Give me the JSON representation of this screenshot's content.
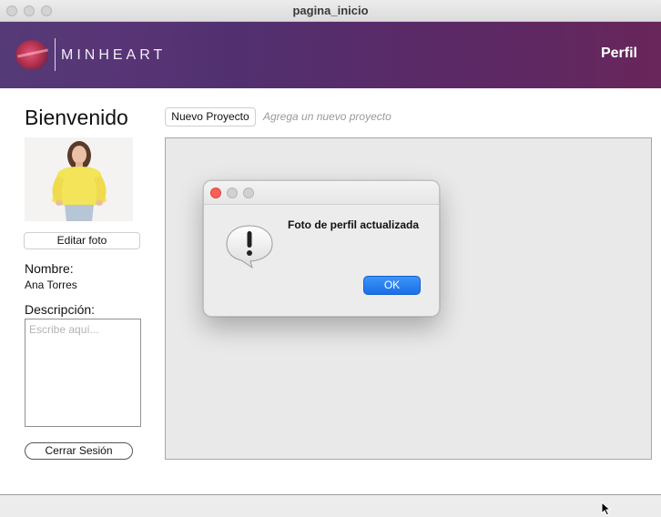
{
  "window": {
    "title": "pagina_inicio"
  },
  "header": {
    "brand": "MINHEART",
    "profile_link": "Perfil"
  },
  "sidebar": {
    "welcome": "Bienvenido",
    "edit_photo_label": "Editar foto",
    "name_label": "Nombre:",
    "name_value": "Ana Torres",
    "description_label": "Descripción:",
    "description_placeholder": "Escribe aquí...",
    "logout_label": "Cerrar Sesión"
  },
  "main": {
    "new_project_label": "Nuevo Proyecto",
    "new_project_hint": "Agrega un nuevo proyecto"
  },
  "dialog": {
    "message": "Foto de perfil actualizada",
    "ok_label": "OK",
    "icon": "exclamation-speech-bubble-icon"
  },
  "colors": {
    "header_left": "#4a3d74",
    "header_right": "#6a2658",
    "ok_button": "#1a6fe8",
    "close_button": "#fc5f57"
  }
}
